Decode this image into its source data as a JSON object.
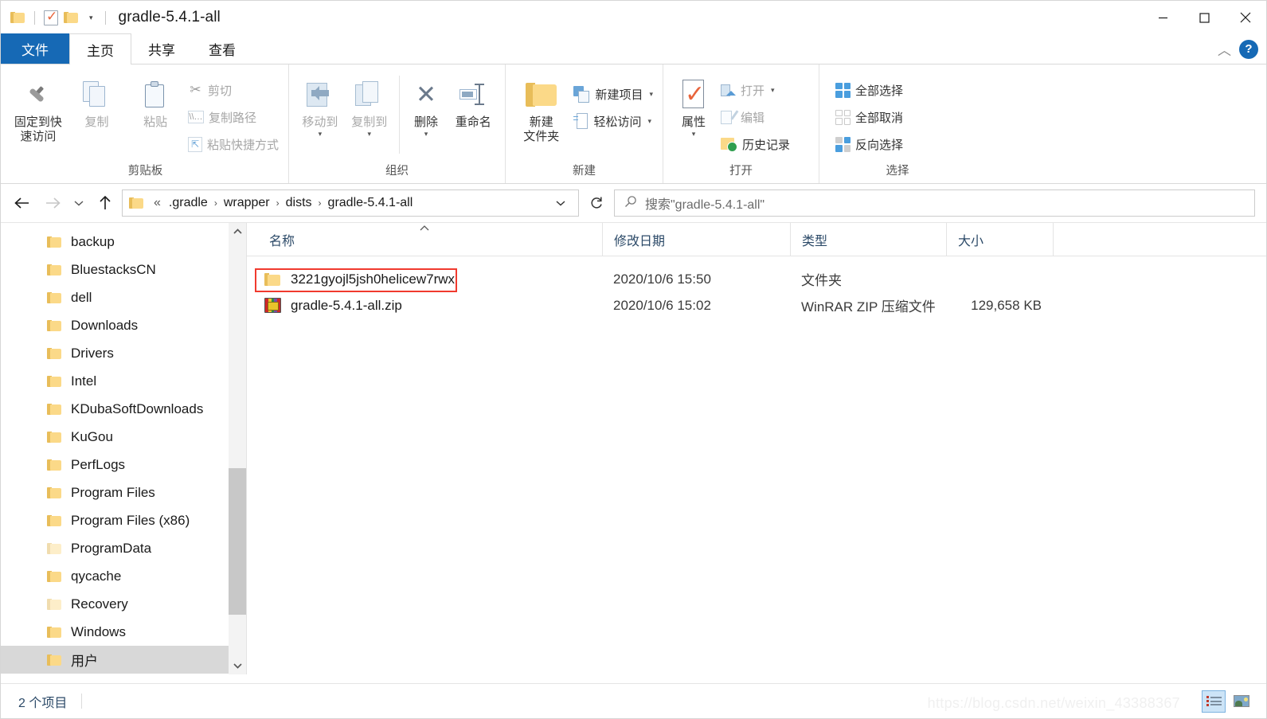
{
  "window": {
    "title": "gradle-5.4.1-all",
    "quick_access": {
      "folder_icon": "folder-icon",
      "properties_icon": "properties-check-icon",
      "new_folder_icon": "new-folder-icon",
      "dropdown_caret": "▾"
    },
    "controls": {
      "minimize": "—",
      "maximize": "☐",
      "close": "✕"
    }
  },
  "ribbon": {
    "tabs": [
      {
        "label": "文件",
        "id": "file",
        "state": "file"
      },
      {
        "label": "主页",
        "id": "home",
        "state": "active"
      },
      {
        "label": "共享",
        "id": "share",
        "state": "normal"
      },
      {
        "label": "查看",
        "id": "view",
        "state": "normal"
      }
    ],
    "collapse_caret": "︿",
    "help_label": "?",
    "groups": {
      "clipboard": {
        "title": "剪贴板",
        "pin": "固定到快\n速访问",
        "pin_line1": "固定到快",
        "pin_line2": "速访问",
        "copy": "复制",
        "paste": "粘贴",
        "cut": "剪切",
        "copy_path": "复制路径",
        "paste_shortcut": "粘贴快捷方式"
      },
      "organize": {
        "title": "组织",
        "move_to": "移动到",
        "copy_to": "复制到",
        "delete": "删除",
        "rename": "重命名",
        "caret": "▾"
      },
      "new": {
        "title": "新建",
        "new_folder_line1": "新建",
        "new_folder_line2": "文件夹",
        "new_item": "新建项目",
        "easy_access": "轻松访问",
        "caret": "▾"
      },
      "open": {
        "title": "打开",
        "properties": "属性",
        "open": "打开",
        "edit": "编辑",
        "history": "历史记录",
        "caret": "▾"
      },
      "select": {
        "title": "选择",
        "select_all": "全部选择",
        "select_none": "全部取消",
        "invert_selection": "反向选择"
      }
    }
  },
  "navigation": {
    "back": "←",
    "forward": "→",
    "recent_caret": "⌄",
    "up": "↑",
    "refresh": "↻",
    "address_caret": "⌄",
    "breadcrumb": {
      "overflow": "«",
      "separator": "›",
      "parts": [
        ".gradle",
        "wrapper",
        "dists",
        "gradle-5.4.1-all"
      ]
    },
    "search": {
      "icon": "search-icon",
      "placeholder": "搜索\"gradle-5.4.1-all\""
    }
  },
  "sidebar": {
    "scroll_up": "︿",
    "scroll_down": "﹀",
    "items": [
      {
        "label": "backup",
        "hidden": false,
        "selected": false
      },
      {
        "label": "BluestacksCN",
        "hidden": false,
        "selected": false
      },
      {
        "label": "dell",
        "hidden": false,
        "selected": false
      },
      {
        "label": "Downloads",
        "hidden": false,
        "selected": false
      },
      {
        "label": "Drivers",
        "hidden": false,
        "selected": false
      },
      {
        "label": "Intel",
        "hidden": false,
        "selected": false
      },
      {
        "label": "KDubaSoftDownloads",
        "hidden": false,
        "selected": false
      },
      {
        "label": "KuGou",
        "hidden": false,
        "selected": false
      },
      {
        "label": "PerfLogs",
        "hidden": false,
        "selected": false
      },
      {
        "label": "Program Files",
        "hidden": false,
        "selected": false
      },
      {
        "label": "Program Files (x86)",
        "hidden": false,
        "selected": false
      },
      {
        "label": "ProgramData",
        "hidden": true,
        "selected": false
      },
      {
        "label": "qycache",
        "hidden": false,
        "selected": false
      },
      {
        "label": "Recovery",
        "hidden": true,
        "selected": false
      },
      {
        "label": "Windows",
        "hidden": false,
        "selected": false
      },
      {
        "label": "用户",
        "hidden": false,
        "selected": true
      }
    ]
  },
  "filelist": {
    "sort_indicator": "︿",
    "columns": [
      {
        "key": "name",
        "label": "名称"
      },
      {
        "key": "date",
        "label": "修改日期"
      },
      {
        "key": "type",
        "label": "类型"
      },
      {
        "key": "size",
        "label": "大小"
      }
    ],
    "rows": [
      {
        "icon": "folder-icon",
        "name": "3221gyojl5jsh0helicew7rwx",
        "date": "2020/10/6 15:50",
        "type": "文件夹",
        "size": "",
        "highlighted": false
      },
      {
        "icon": "winrar-zip-icon",
        "name": "gradle-5.4.1-all.zip",
        "date": "2020/10/6 15:02",
        "type": "WinRAR ZIP 压缩文件",
        "size": "129,658 KB",
        "highlighted": true
      }
    ],
    "highlight_color": "#f03a2e"
  },
  "statusbar": {
    "item_count": "2 个项目",
    "view_details_icon": "details-view-icon",
    "view_thumbnails_icon": "thumbnail-view-icon"
  },
  "watermark": {
    "text": "https://blog.csdn.net/weixin_43388367"
  }
}
